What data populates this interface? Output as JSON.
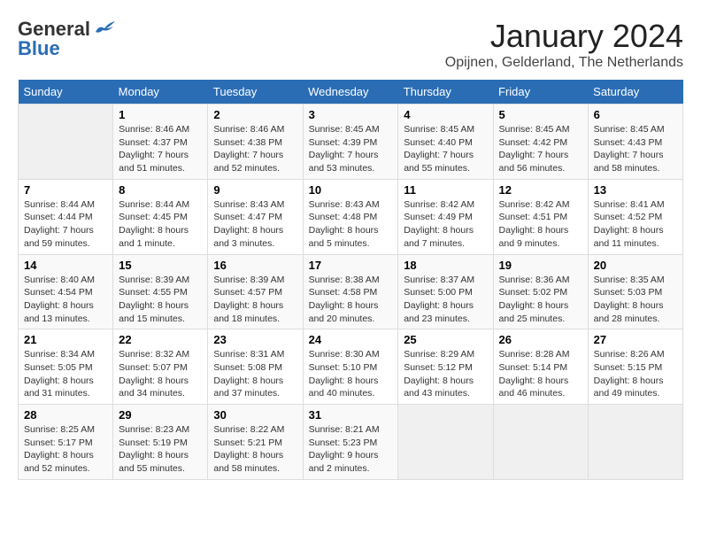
{
  "header": {
    "logo_general": "General",
    "logo_blue": "Blue",
    "title": "January 2024",
    "location": "Opijnen, Gelderland, The Netherlands"
  },
  "calendar": {
    "weekdays": [
      "Sunday",
      "Monday",
      "Tuesday",
      "Wednesday",
      "Thursday",
      "Friday",
      "Saturday"
    ],
    "weeks": [
      [
        {
          "day": "",
          "empty": true
        },
        {
          "day": "1",
          "sunrise": "Sunrise: 8:46 AM",
          "sunset": "Sunset: 4:37 PM",
          "daylight": "Daylight: 7 hours and 51 minutes."
        },
        {
          "day": "2",
          "sunrise": "Sunrise: 8:46 AM",
          "sunset": "Sunset: 4:38 PM",
          "daylight": "Daylight: 7 hours and 52 minutes."
        },
        {
          "day": "3",
          "sunrise": "Sunrise: 8:45 AM",
          "sunset": "Sunset: 4:39 PM",
          "daylight": "Daylight: 7 hours and 53 minutes."
        },
        {
          "day": "4",
          "sunrise": "Sunrise: 8:45 AM",
          "sunset": "Sunset: 4:40 PM",
          "daylight": "Daylight: 7 hours and 55 minutes."
        },
        {
          "day": "5",
          "sunrise": "Sunrise: 8:45 AM",
          "sunset": "Sunset: 4:42 PM",
          "daylight": "Daylight: 7 hours and 56 minutes."
        },
        {
          "day": "6",
          "sunrise": "Sunrise: 8:45 AM",
          "sunset": "Sunset: 4:43 PM",
          "daylight": "Daylight: 7 hours and 58 minutes."
        }
      ],
      [
        {
          "day": "7",
          "sunrise": "Sunrise: 8:44 AM",
          "sunset": "Sunset: 4:44 PM",
          "daylight": "Daylight: 7 hours and 59 minutes."
        },
        {
          "day": "8",
          "sunrise": "Sunrise: 8:44 AM",
          "sunset": "Sunset: 4:45 PM",
          "daylight": "Daylight: 8 hours and 1 minute."
        },
        {
          "day": "9",
          "sunrise": "Sunrise: 8:43 AM",
          "sunset": "Sunset: 4:47 PM",
          "daylight": "Daylight: 8 hours and 3 minutes."
        },
        {
          "day": "10",
          "sunrise": "Sunrise: 8:43 AM",
          "sunset": "Sunset: 4:48 PM",
          "daylight": "Daylight: 8 hours and 5 minutes."
        },
        {
          "day": "11",
          "sunrise": "Sunrise: 8:42 AM",
          "sunset": "Sunset: 4:49 PM",
          "daylight": "Daylight: 8 hours and 7 minutes."
        },
        {
          "day": "12",
          "sunrise": "Sunrise: 8:42 AM",
          "sunset": "Sunset: 4:51 PM",
          "daylight": "Daylight: 8 hours and 9 minutes."
        },
        {
          "day": "13",
          "sunrise": "Sunrise: 8:41 AM",
          "sunset": "Sunset: 4:52 PM",
          "daylight": "Daylight: 8 hours and 11 minutes."
        }
      ],
      [
        {
          "day": "14",
          "sunrise": "Sunrise: 8:40 AM",
          "sunset": "Sunset: 4:54 PM",
          "daylight": "Daylight: 8 hours and 13 minutes."
        },
        {
          "day": "15",
          "sunrise": "Sunrise: 8:39 AM",
          "sunset": "Sunset: 4:55 PM",
          "daylight": "Daylight: 8 hours and 15 minutes."
        },
        {
          "day": "16",
          "sunrise": "Sunrise: 8:39 AM",
          "sunset": "Sunset: 4:57 PM",
          "daylight": "Daylight: 8 hours and 18 minutes."
        },
        {
          "day": "17",
          "sunrise": "Sunrise: 8:38 AM",
          "sunset": "Sunset: 4:58 PM",
          "daylight": "Daylight: 8 hours and 20 minutes."
        },
        {
          "day": "18",
          "sunrise": "Sunrise: 8:37 AM",
          "sunset": "Sunset: 5:00 PM",
          "daylight": "Daylight: 8 hours and 23 minutes."
        },
        {
          "day": "19",
          "sunrise": "Sunrise: 8:36 AM",
          "sunset": "Sunset: 5:02 PM",
          "daylight": "Daylight: 8 hours and 25 minutes."
        },
        {
          "day": "20",
          "sunrise": "Sunrise: 8:35 AM",
          "sunset": "Sunset: 5:03 PM",
          "daylight": "Daylight: 8 hours and 28 minutes."
        }
      ],
      [
        {
          "day": "21",
          "sunrise": "Sunrise: 8:34 AM",
          "sunset": "Sunset: 5:05 PM",
          "daylight": "Daylight: 8 hours and 31 minutes."
        },
        {
          "day": "22",
          "sunrise": "Sunrise: 8:32 AM",
          "sunset": "Sunset: 5:07 PM",
          "daylight": "Daylight: 8 hours and 34 minutes."
        },
        {
          "day": "23",
          "sunrise": "Sunrise: 8:31 AM",
          "sunset": "Sunset: 5:08 PM",
          "daylight": "Daylight: 8 hours and 37 minutes."
        },
        {
          "day": "24",
          "sunrise": "Sunrise: 8:30 AM",
          "sunset": "Sunset: 5:10 PM",
          "daylight": "Daylight: 8 hours and 40 minutes."
        },
        {
          "day": "25",
          "sunrise": "Sunrise: 8:29 AM",
          "sunset": "Sunset: 5:12 PM",
          "daylight": "Daylight: 8 hours and 43 minutes."
        },
        {
          "day": "26",
          "sunrise": "Sunrise: 8:28 AM",
          "sunset": "Sunset: 5:14 PM",
          "daylight": "Daylight: 8 hours and 46 minutes."
        },
        {
          "day": "27",
          "sunrise": "Sunrise: 8:26 AM",
          "sunset": "Sunset: 5:15 PM",
          "daylight": "Daylight: 8 hours and 49 minutes."
        }
      ],
      [
        {
          "day": "28",
          "sunrise": "Sunrise: 8:25 AM",
          "sunset": "Sunset: 5:17 PM",
          "daylight": "Daylight: 8 hours and 52 minutes."
        },
        {
          "day": "29",
          "sunrise": "Sunrise: 8:23 AM",
          "sunset": "Sunset: 5:19 PM",
          "daylight": "Daylight: 8 hours and 55 minutes."
        },
        {
          "day": "30",
          "sunrise": "Sunrise: 8:22 AM",
          "sunset": "Sunset: 5:21 PM",
          "daylight": "Daylight: 8 hours and 58 minutes."
        },
        {
          "day": "31",
          "sunrise": "Sunrise: 8:21 AM",
          "sunset": "Sunset: 5:23 PM",
          "daylight": "Daylight: 9 hours and 2 minutes."
        },
        {
          "day": "",
          "empty": true
        },
        {
          "day": "",
          "empty": true
        },
        {
          "day": "",
          "empty": true
        }
      ]
    ]
  }
}
